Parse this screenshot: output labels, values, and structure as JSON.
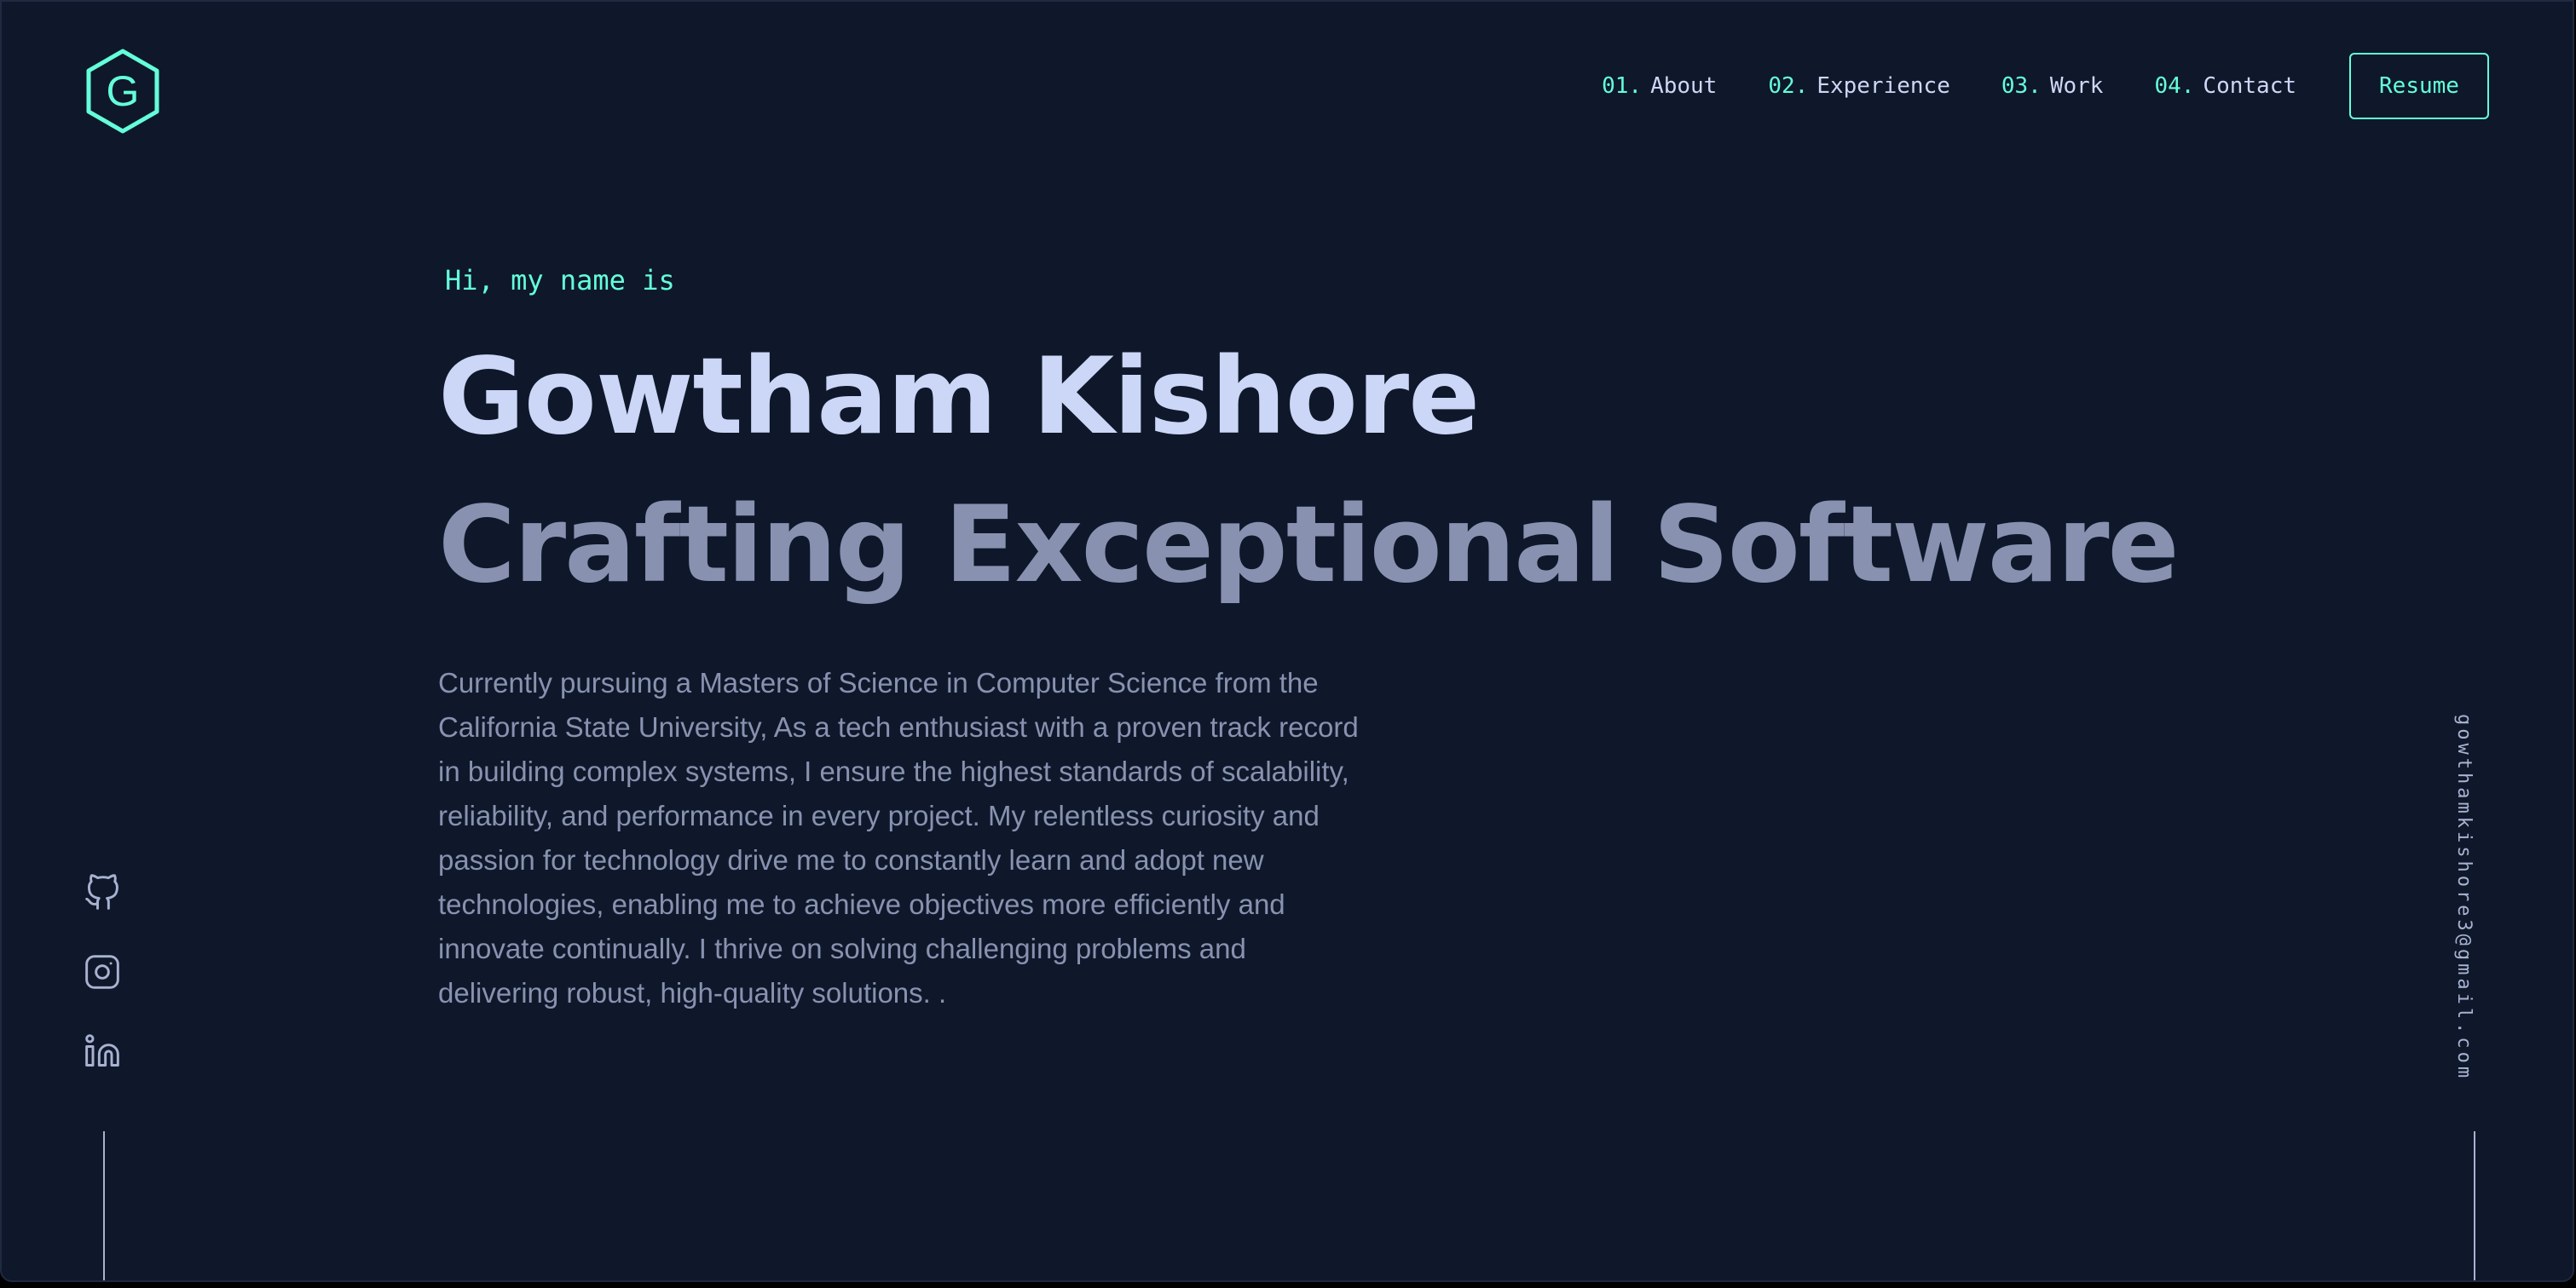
{
  "colors": {
    "background": "#0e182a",
    "accent": "#64ffda",
    "heading": "#ccd6f6",
    "subheading": "#8892b0",
    "body_text": "#8892b0"
  },
  "logo": {
    "letter": "G",
    "icon": "hexagon-logo-icon"
  },
  "nav": {
    "items": [
      {
        "num": "01.",
        "label": "About"
      },
      {
        "num": "02.",
        "label": "Experience"
      },
      {
        "num": "03.",
        "label": "Work"
      },
      {
        "num": "04.",
        "label": "Contact"
      }
    ],
    "resume_label": "Resume"
  },
  "hero": {
    "greeting": "Hi, my name is",
    "name": "Gowtham Kishore",
    "tagline": "Crafting Exceptional Software",
    "bio": "Currently pursuing a Masters of Science in Computer Science from the California State University, As a tech enthusiast with a proven track record in building complex systems, I ensure the highest standards of scalability, reliability, and performance in every project. My relentless curiosity and passion for technology drive me to constantly learn and adopt new technologies, enabling me to achieve objectives more efficiently and innovate continually. I thrive on solving challenging problems and delivering robust, high-quality solutions. ."
  },
  "social": {
    "icons": [
      "github-icon",
      "instagram-icon",
      "linkedin-icon"
    ]
  },
  "email": "gowthamkishore3@gmail.com"
}
